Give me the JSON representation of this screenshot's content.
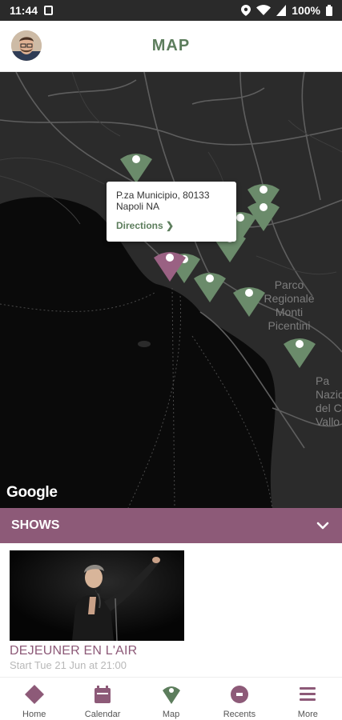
{
  "status_bar": {
    "time": "11:44",
    "battery": "100%"
  },
  "header": {
    "title": "MAP"
  },
  "map": {
    "labels": [
      "Parco",
      "Regionale",
      "Monti",
      "Picentini",
      "Pa",
      "Nazio",
      "del Ci",
      "Vallo"
    ],
    "popup": {
      "address": "P.za Municipio, 80133 Napoli NA",
      "directions_label": "Directions ❯"
    },
    "attribution": "Google",
    "marker_color": "#6b8b6b",
    "selected_marker_color": "#9a6183"
  },
  "shows": {
    "section_title": "SHOWS",
    "items": [
      {
        "title": "DEJEUNER EN L'AIR",
        "date": "Start Tue 21 Jun at 21:00"
      }
    ]
  },
  "nav": {
    "items": [
      {
        "label": "Home",
        "icon": "diamond-icon"
      },
      {
        "label": "Calendar",
        "icon": "calendar-icon"
      },
      {
        "label": "Map",
        "icon": "map-pin-icon"
      },
      {
        "label": "Recents",
        "icon": "ticket-icon"
      },
      {
        "label": "More",
        "icon": "menu-icon"
      }
    ]
  },
  "colors": {
    "accent": "#8d5a78",
    "title_green": "#5c7d5c"
  }
}
